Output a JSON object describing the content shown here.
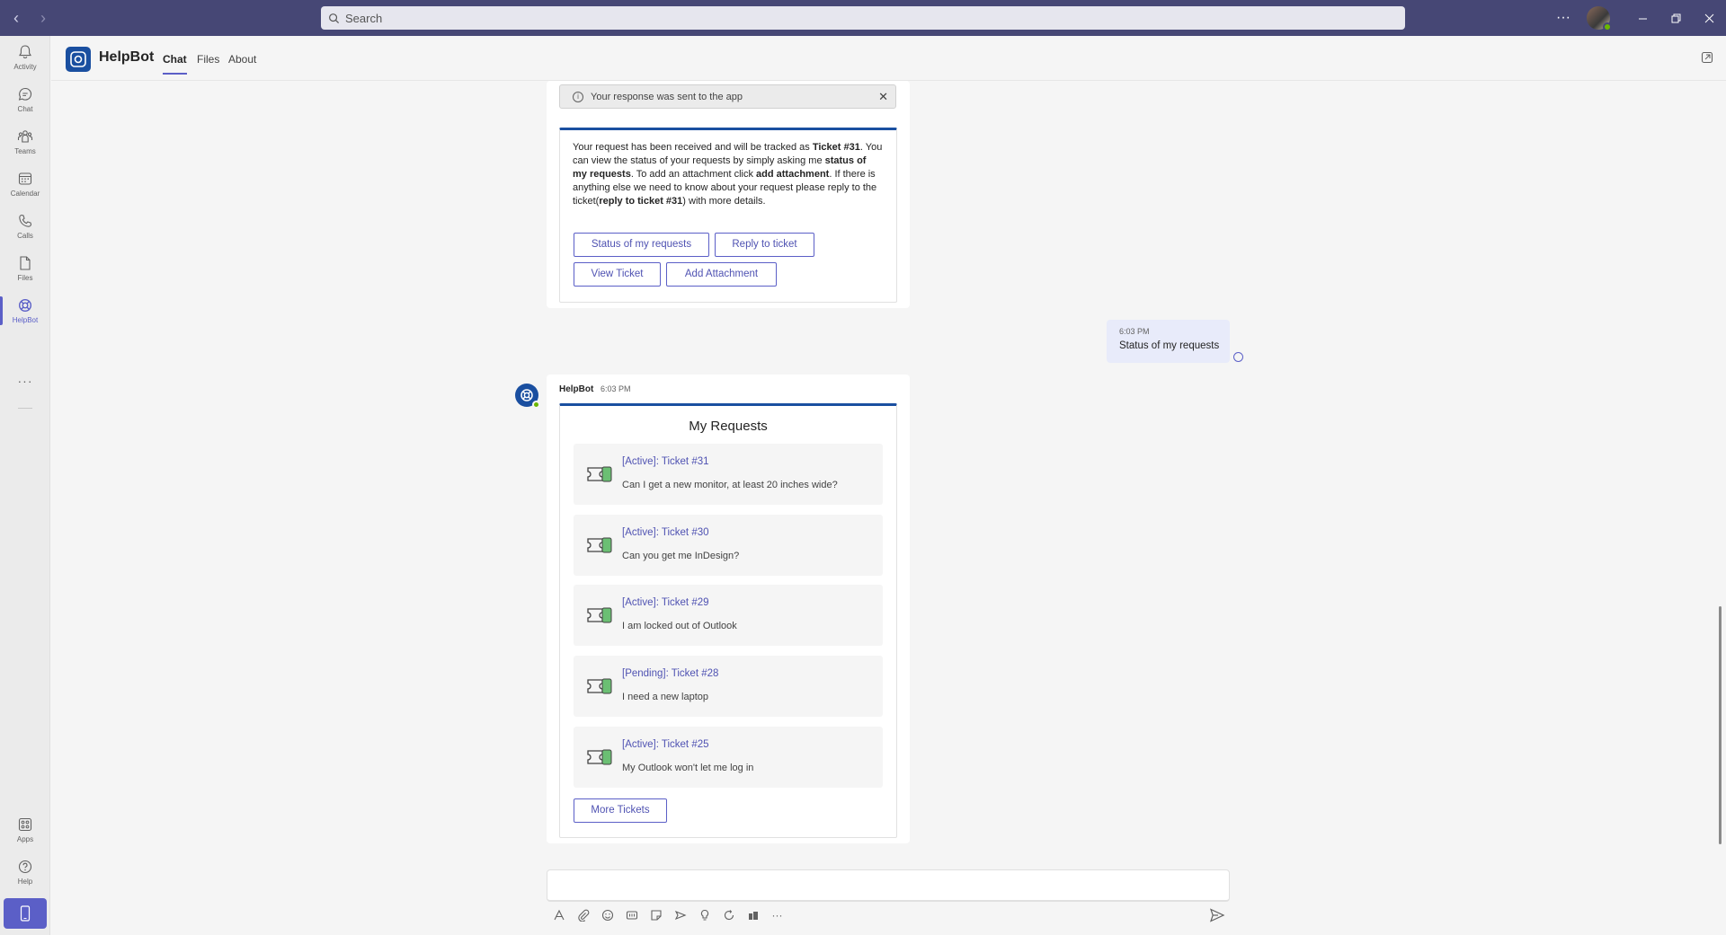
{
  "titlebar": {
    "search_placeholder": "Search",
    "more_label": "···"
  },
  "rail": {
    "items": [
      {
        "label": "Activity",
        "icon": "bell-icon"
      },
      {
        "label": "Chat",
        "icon": "chat-icon"
      },
      {
        "label": "Teams",
        "icon": "teams-icon"
      },
      {
        "label": "Calendar",
        "icon": "calendar-icon"
      },
      {
        "label": "Calls",
        "icon": "phone-icon"
      },
      {
        "label": "Files",
        "icon": "file-icon"
      },
      {
        "label": "HelpBot",
        "icon": "lifebuoy-icon"
      }
    ],
    "more_label": "···",
    "bottom_items": [
      {
        "label": "Apps",
        "icon": "apps-icon"
      },
      {
        "label": "Help",
        "icon": "help-icon"
      }
    ]
  },
  "app_header": {
    "name": "HelpBot",
    "tabs": [
      {
        "label": "Chat",
        "active": true
      },
      {
        "label": "Files",
        "active": false
      },
      {
        "label": "About",
        "active": false
      }
    ]
  },
  "notice": {
    "text": "Your response was sent to the app",
    "close": "✕"
  },
  "first_card": {
    "t1": "Your request has been received and will be tracked as ",
    "b1": "Ticket #31",
    "t2": ". You can view the status of your requests by simply asking me ",
    "b2": "status of my requests",
    "t3": ". To add an attachment click ",
    "b3": "add attachment",
    "t4": ". If there is anything else we need to know about your request please reply to the ticket(",
    "b4": "reply to ticket #31",
    "t5": ") with more details.",
    "buttons": [
      "Status of my requests",
      "Reply to ticket",
      "View Ticket",
      "Add Attachment"
    ]
  },
  "user_message": {
    "time": "6:03 PM",
    "text": "Status of my requests"
  },
  "bot_message": {
    "sender": "HelpBot",
    "time": "6:03 PM",
    "title": "My Requests",
    "tickets": [
      {
        "link": "[Active]: Ticket #31",
        "desc": "Can I get a new monitor, at least 20 inches wide?"
      },
      {
        "link": "[Active]: Ticket #30",
        "desc": "Can you get me InDesign?"
      },
      {
        "link": "[Active]: Ticket #29",
        "desc": "I am locked out of Outlook"
      },
      {
        "link": "[Pending]: Ticket #28",
        "desc": "I need a new laptop"
      },
      {
        "link": "[Active]: Ticket #25",
        "desc": "My Outlook won't let me log in"
      }
    ],
    "more_button": "More Tickets"
  },
  "colors": {
    "titlebar": "#464775",
    "accent": "#5b5fc7",
    "card_border": "#1a4fa0",
    "ticket_green": "#6bbf73"
  }
}
